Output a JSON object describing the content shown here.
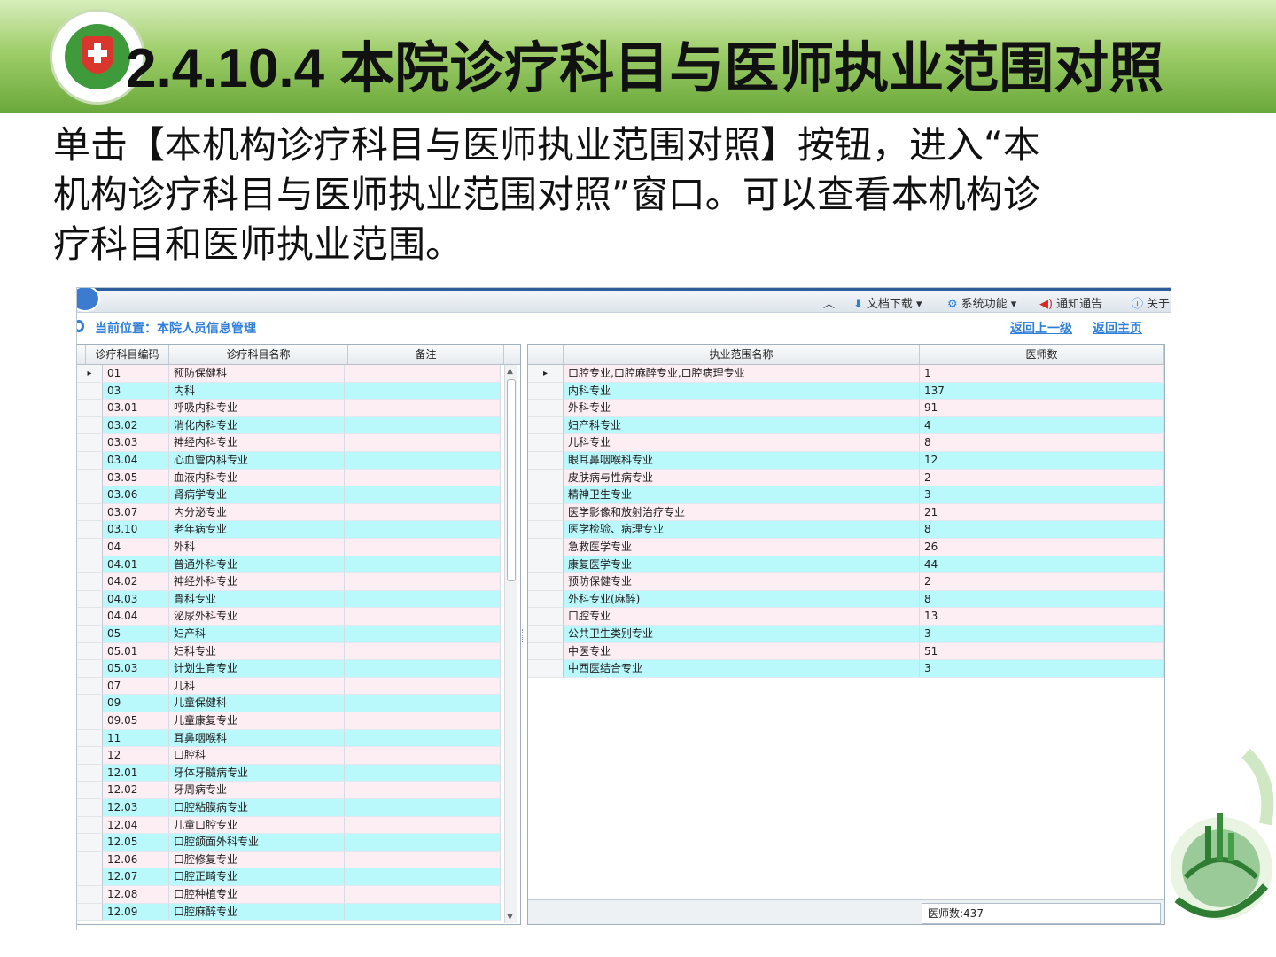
{
  "slide": {
    "title": "2.4.10.4  本院诊疗科目与医师执业范围对照",
    "lines": [
      "单击【本机构诊疗科目与医师执业范围对照】按钮，进入“本",
      "机构诊疗科目与医师执业范围对照”窗口。可以查看本机构诊",
      "疗科目和医师执业范围。"
    ]
  },
  "toolbar": {
    "items": [
      {
        "icon": "chevron-up-icon",
        "label": ""
      },
      {
        "icon": "download-icon",
        "label": "文档下载"
      },
      {
        "icon": "gear-icon",
        "label": "系统功能"
      },
      {
        "icon": "speaker-icon",
        "label": "通知通告"
      },
      {
        "icon": "info-icon",
        "label": "关于"
      }
    ]
  },
  "location": {
    "label": "当前位置：本院人员信息管理",
    "back_up": "返回上一级",
    "back_home": "返回主页"
  },
  "left_table": {
    "headers": [
      "诊疗科目编码",
      "诊疗科目名称",
      "备注"
    ],
    "rows": [
      [
        "01",
        "预防保健科",
        ""
      ],
      [
        "03",
        "内科",
        ""
      ],
      [
        "03.01",
        "呼吸内科专业",
        ""
      ],
      [
        "03.02",
        "消化内科专业",
        ""
      ],
      [
        "03.03",
        "神经内科专业",
        ""
      ],
      [
        "03.04",
        "心血管内科专业",
        ""
      ],
      [
        "03.05",
        "血液内科专业",
        ""
      ],
      [
        "03.06",
        "肾病学专业",
        ""
      ],
      [
        "03.07",
        "内分泌专业",
        ""
      ],
      [
        "03.10",
        "老年病专业",
        ""
      ],
      [
        "04",
        "外科",
        ""
      ],
      [
        "04.01",
        "普通外科专业",
        ""
      ],
      [
        "04.02",
        "神经外科专业",
        ""
      ],
      [
        "04.03",
        "骨科专业",
        ""
      ],
      [
        "04.04",
        "泌尿外科专业",
        ""
      ],
      [
        "05",
        "妇产科",
        ""
      ],
      [
        "05.01",
        "妇科专业",
        ""
      ],
      [
        "05.03",
        "计划生育专业",
        ""
      ],
      [
        "07",
        "儿科",
        ""
      ],
      [
        "09",
        "儿童保健科",
        ""
      ],
      [
        "09.05",
        "儿童康复专业",
        ""
      ],
      [
        "11",
        "耳鼻咽喉科",
        ""
      ],
      [
        "12",
        "口腔科",
        ""
      ],
      [
        "12.01",
        "牙体牙髓病专业",
        ""
      ],
      [
        "12.02",
        "牙周病专业",
        ""
      ],
      [
        "12.03",
        "口腔粘膜病专业",
        ""
      ],
      [
        "12.04",
        "儿童口腔专业",
        ""
      ],
      [
        "12.05",
        "口腔颌面外科专业",
        ""
      ],
      [
        "12.06",
        "口腔修复专业",
        ""
      ],
      [
        "12.07",
        "口腔正畸专业",
        ""
      ],
      [
        "12.08",
        "口腔种植专业",
        ""
      ],
      [
        "12.09",
        "口腔麻醉专业",
        ""
      ]
    ]
  },
  "right_table": {
    "headers": [
      "执业范围名称",
      "医师数"
    ],
    "rows": [
      [
        "口腔专业,口腔麻醉专业,口腔病理专业",
        "1"
      ],
      [
        "内科专业",
        "137"
      ],
      [
        "外科专业",
        "91"
      ],
      [
        "妇产科专业",
        "4"
      ],
      [
        "儿科专业",
        "8"
      ],
      [
        "眼耳鼻咽喉科专业",
        "12"
      ],
      [
        "皮肤病与性病专业",
        "2"
      ],
      [
        "精神卫生专业",
        "3"
      ],
      [
        "医学影像和放射治疗专业",
        "21"
      ],
      [
        "医学检验、病理专业",
        "8"
      ],
      [
        "急救医学专业",
        "26"
      ],
      [
        "康复医学专业",
        "44"
      ],
      [
        "预防保健专业",
        "2"
      ],
      [
        "外科专业(麻醉)",
        "8"
      ],
      [
        "口腔专业",
        "13"
      ],
      [
        "公共卫生类别专业",
        "3"
      ],
      [
        "中医专业",
        "51"
      ],
      [
        "中西医结合专业",
        "3"
      ]
    ],
    "footer": "医师数:437"
  },
  "colors": {
    "row_pink": "#fdeef3",
    "row_cyan": "#b9f8fb",
    "link": "#2f7ed8",
    "banner": "#6aa83a"
  }
}
